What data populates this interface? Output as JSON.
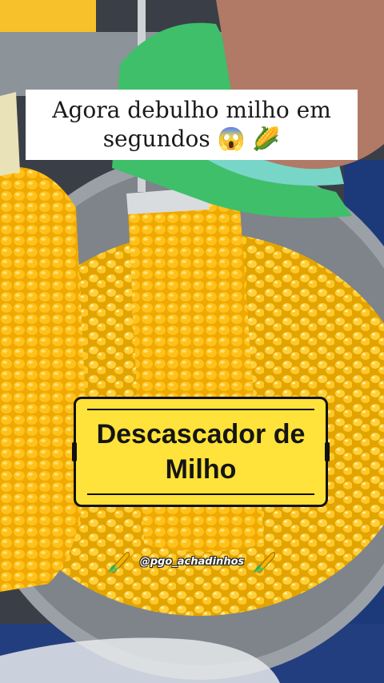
{
  "caption": {
    "line1": "Agora debulho milho em",
    "line2": "segundos 😱 🌽"
  },
  "title_card": {
    "text": "Descascador de\nMilho",
    "background": "#ffe23a",
    "border": "#111111"
  },
  "watermark": {
    "handle": "@pgo_achadinhos",
    "icon_left": "corn-icon",
    "icon_right": "corn-icon"
  },
  "colors": {
    "corn": "#f7b500",
    "corn_light": "#ffd23a",
    "towel": "#3fbf6a",
    "pot": "#a9adb1",
    "shirt": "#1c3a7a"
  }
}
